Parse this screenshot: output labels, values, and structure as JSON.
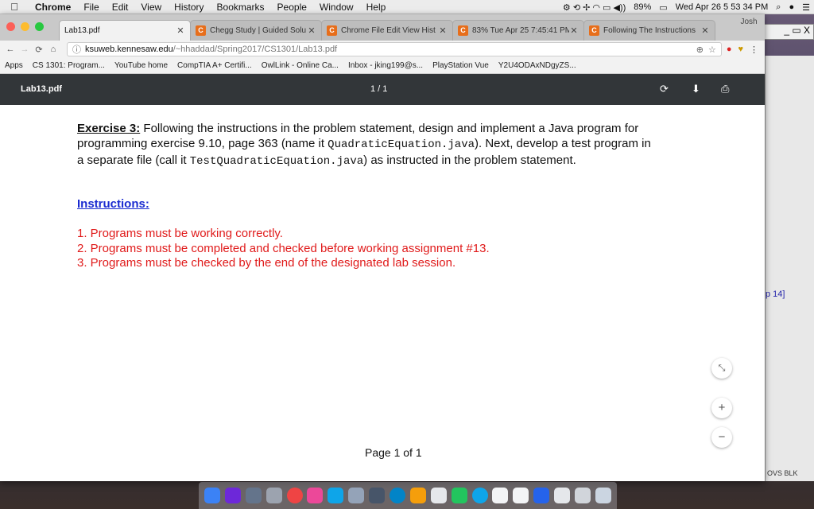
{
  "menubar": {
    "app": "Chrome",
    "items": [
      "File",
      "Edit",
      "View",
      "History",
      "Bookmarks",
      "People",
      "Window",
      "Help"
    ],
    "battery": "89%",
    "clock": "Wed Apr 26  5 53 34 PM"
  },
  "tabs": [
    {
      "label": "Lab13.pdf",
      "icon": "document-icon"
    },
    {
      "label": "Chegg Study | Guided Solu",
      "icon": "chegg-icon"
    },
    {
      "label": "Chrome File Edit View Hist",
      "icon": "chegg-icon"
    },
    {
      "label": "83% Tue Apr 25 7:45:41 PM",
      "icon": "chegg-icon"
    },
    {
      "label": "Following The Instructions",
      "icon": "chegg-icon"
    }
  ],
  "profile": "Josh",
  "url": {
    "host": "ksuweb.kennesaw.edu",
    "path": "/~hhaddad/Spring2017/CS1301/Lab13.pdf"
  },
  "bookmarks": [
    "Apps",
    "CS 1301: Program...",
    "YouTube home",
    "CompTIA A+ Certifi...",
    "OwlLink - Online Ca...",
    "Inbox - jking199@s...",
    "PlayStation Vue",
    "Y2U4ODAxNDgyZS..."
  ],
  "pdf": {
    "title": "Lab13.pdf",
    "page_indicator": "1 / 1",
    "footer": "Page 1 of 1"
  },
  "doc": {
    "exercise_label": "Exercise 3:",
    "line1": " Following the instructions in the problem statement, design and implement a Java program for",
    "line2_a": "programming exercise 9.10, page 363 (name it ",
    "line2_code": "QuadraticEquation.java",
    "line2_b": ").  Next, develop a test program in",
    "line3_a": "a separate file (call it ",
    "line3_code": "TestQuadraticEquation.java",
    "line3_b": ") as instructed in the problem statement.",
    "instructions_heading": "Instructions:",
    "items": [
      "1.  Programs must be working correctly.",
      "2.  Programs must be completed and checked before working assignment #13.",
      "3.  Programs must be checked by the end of the designated lab session."
    ]
  },
  "side": {
    "top_buttons": "_ ▭ X",
    "label1": "p 14]",
    "label2": "OVS BLK"
  }
}
